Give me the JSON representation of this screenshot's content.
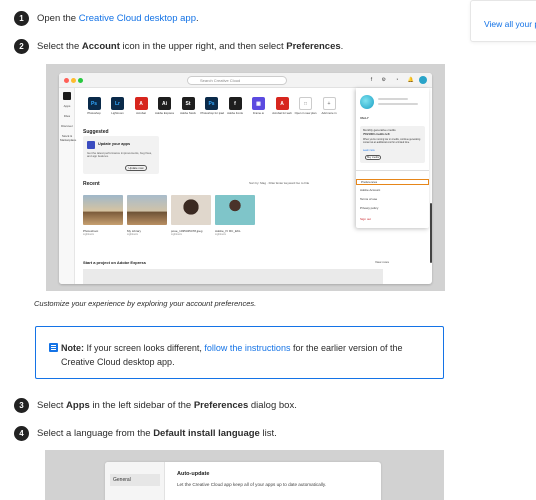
{
  "steps": [
    {
      "num": "1",
      "pre": "Open the ",
      "link": "Creative Cloud desktop app",
      "post": "."
    },
    {
      "num": "2",
      "pre": "Select the ",
      "b1": "Account",
      "mid": " icon in the upper right, and then select ",
      "b2": "Preferences",
      "post": "."
    },
    {
      "num": "3",
      "pre": "Select ",
      "b1": "Apps",
      "mid": " in the left sidebar of the ",
      "b2": "Preferences",
      "post": " dialog box."
    },
    {
      "num": "4",
      "pre": "Select a language from the ",
      "b1": "Default install language",
      "post": " list."
    }
  ],
  "right_link": "View all your pla",
  "screenshot1": {
    "search_placeholder": "Search Creative Cloud",
    "topbar_icons": "f ⚙ ◔ 🔔",
    "sidebar": [
      {
        "label": "Apps"
      },
      {
        "label": "Files"
      },
      {
        "label": "Discover"
      },
      {
        "label": "Stock & Marketplace"
      }
    ],
    "apps": [
      {
        "abbr": "Ps",
        "label": "Photoshop",
        "color": "#0a2a4a",
        "fg": "#31a8ff"
      },
      {
        "abbr": "Lr",
        "label": "Lightroom",
        "color": "#0a2a4a",
        "fg": "#31a8ff"
      },
      {
        "abbr": "A",
        "label": "Acrobat",
        "color": "#d7261e",
        "fg": "#ffffff"
      },
      {
        "abbr": "Ai",
        "label": "Adobe Express",
        "color": "#1e1e1e",
        "fg": "#ffffff"
      },
      {
        "abbr": "St",
        "label": "Adobe Stock",
        "color": "#1e1e1e",
        "fg": "#ffffff"
      },
      {
        "abbr": "Ps",
        "label": "Photoshop for ipad",
        "color": "#0a2a4a",
        "fg": "#31a8ff"
      },
      {
        "abbr": "f",
        "label": "Adobe Fonts",
        "color": "#1e1e1e",
        "fg": "#ffffff"
      },
      {
        "abbr": "▦",
        "label": "Frame.io",
        "color": "#5b4ae0",
        "fg": "#ffffff"
      },
      {
        "abbr": "A",
        "label": "Acrobat for web",
        "color": "#d7261e",
        "fg": "#ffffff"
      },
      {
        "abbr": "□",
        "label": "Open in new plan",
        "color": "#ffffff",
        "fg": "#888888"
      },
      {
        "abbr": "+",
        "label": "Add more in",
        "color": "#ffffff",
        "fg": "#888888"
      }
    ],
    "suggested": {
      "title": "Suggested",
      "card_title": "Update your apps",
      "card_text": "Get the latest performance improvements, bug fixes, and app features.",
      "card_button": "Update now"
    },
    "recent": {
      "title": "Recent",
      "tools": "Sort by: Mag  ·  Filter  Enter keyword     Go to File",
      "items": [
        {
          "name": "Photoshoot",
          "meta": "Lightroom"
        },
        {
          "name": "My Library",
          "meta": "Lightroom"
        },
        {
          "name": "pose_1035345478.jpeg",
          "meta": "Lightroom"
        },
        {
          "name": "Adobe_IV RC_EKL",
          "meta": "Lightroom"
        }
      ]
    },
    "start": "Start a project on Adobe Express",
    "view_more": "View more",
    "account_panel": {
      "plan": "VALLY",
      "credits_title": "Monthly generative credits",
      "credits_value": "750/1000 credits left",
      "credits_text": "When you're running low on credits, continue generating content at an additional cost for a limited time.",
      "learn_more": "Learn more",
      "buy_button": "Buy credits",
      "menu": [
        "Preferences",
        "Adobe Account",
        "Terms of use",
        "Privacy policy",
        "Sign out"
      ]
    }
  },
  "caption": "Customize your experience by exploring your account preferences.",
  "note": {
    "label": "Note:",
    "pre": " If your screen looks different, ",
    "link": "follow the instructions",
    "post": " for the earlier version of the Creative Cloud desktop app."
  },
  "screenshot2": {
    "sidebar_item": "General",
    "heading": "Auto-update",
    "text": "Let the Creative Cloud app keep all of your apps up to date automatically."
  },
  "colors": {
    "link": "#1473e6",
    "highlight": "#e68619",
    "step_badge": "#222222"
  }
}
